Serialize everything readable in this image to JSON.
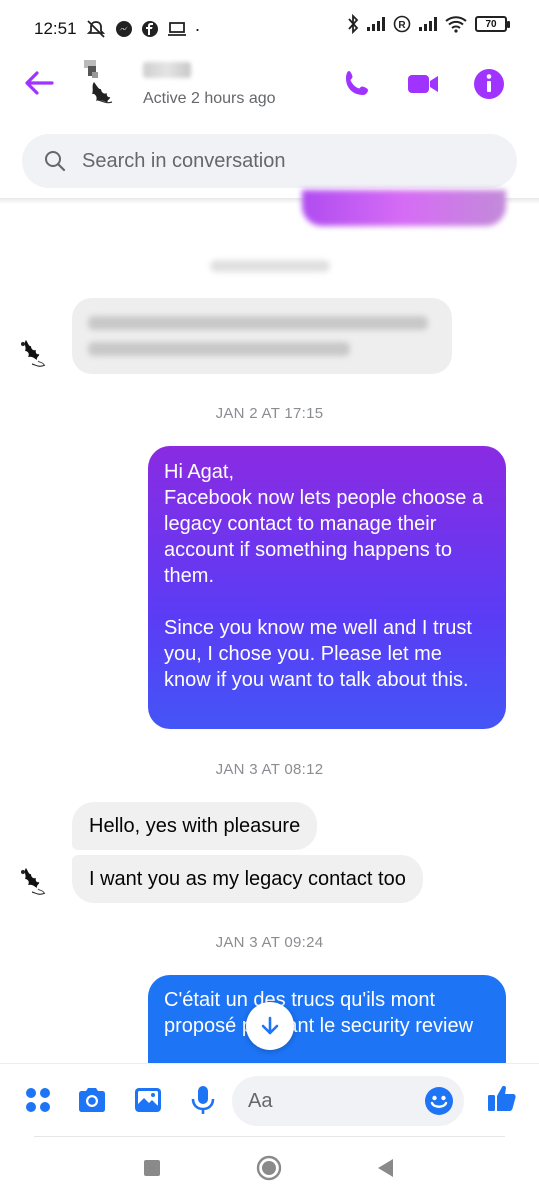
{
  "status_bar": {
    "time": "12:51",
    "battery": "70"
  },
  "header": {
    "active_status": "Active 2 hours ago"
  },
  "search": {
    "placeholder": "Search in conversation"
  },
  "messages": {
    "date_1": "JAN 2 AT 17:15",
    "outgoing_1": "Hi Agat,\nFacebook now lets people choose a legacy contact to manage their account if something happens to them.\n\nSince you know me well and I trust you, I chose you. Please let me know if you want to talk about this.",
    "date_2": "JAN 3 AT 08:12",
    "incoming_1": "Hello, yes with pleasure",
    "incoming_2": "I want you as my legacy contact too",
    "date_3": "JAN 3 AT 09:24",
    "outgoing_2": "C'était un des trucs qu'ils mont proposé pendant le security review"
  },
  "composer": {
    "placeholder": "Aa"
  },
  "colors": {
    "accent": "#a033ff",
    "messenger_blue": "#1d74f5"
  },
  "icons": [
    "back-arrow-icon",
    "phone-icon",
    "video-icon",
    "info-icon",
    "search-icon",
    "menu-dots-icon",
    "camera-icon",
    "image-icon",
    "mic-icon",
    "emoji-icon",
    "like-icon",
    "arrow-down-icon"
  ]
}
